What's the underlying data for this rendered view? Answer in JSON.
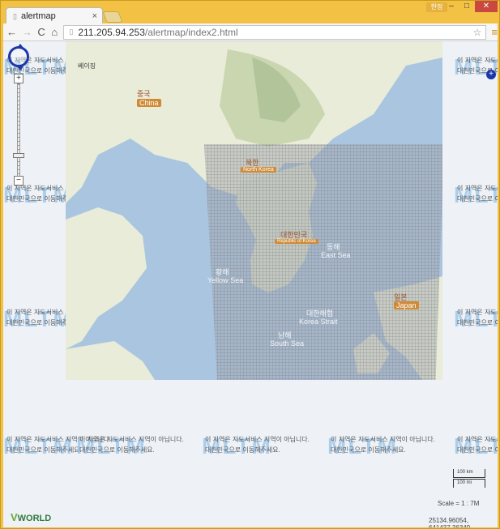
{
  "browser": {
    "tab_title": "alertmap",
    "tab_close": "×",
    "window_user": "한정",
    "minimize": "–",
    "restore": "□",
    "close": "✕",
    "url_host": "211.205.94.253",
    "url_path": "/alertmap/index2.html",
    "back": "←",
    "forward": "→",
    "reload": "C",
    "home": "⌂",
    "star": "☆",
    "menu": "≡"
  },
  "watermark": {
    "brand": "MLTM",
    "line1": "이 지역은 지도서비스 지역이 아닙니다.",
    "line2": "대한민국으로 이동해주세요."
  },
  "map": {
    "labels": {
      "beijing": "베이징",
      "china": "중국",
      "china_en": "China",
      "bukhan": "북한",
      "bukhan_en": "North Korea",
      "korea": "대한민국",
      "korea_en": "Republic of Korea",
      "east_sea": "동해",
      "east_sea_en": "East Sea",
      "yellow_sea": "황해",
      "yellow_sea_en": "Yellow Sea",
      "korea_strait": "대한해협",
      "korea_strait_en": "Korea Strait",
      "south_sea": "남해",
      "south_sea_en": "South Sea",
      "japan": "일본",
      "japan_en": "Japan"
    }
  },
  "zoom": {
    "plus": "+",
    "minus": "−"
  },
  "scale": {
    "km": "100 km",
    "mi": "100 mi",
    "text": "Scale = 1 : 7M"
  },
  "coords": "25134.96054, 641437.36349",
  "logo": {
    "v": "V",
    "text": "WORLD"
  },
  "right_plus": "+"
}
